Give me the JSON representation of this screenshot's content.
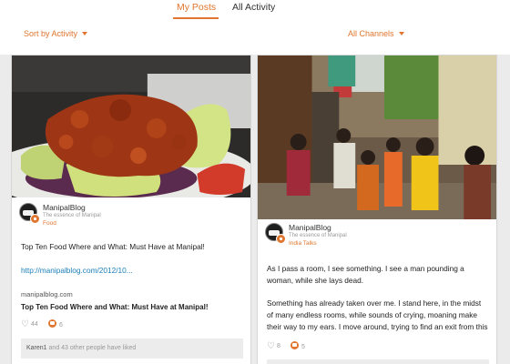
{
  "tabs": [
    {
      "label": "My Posts",
      "active": true
    },
    {
      "label": "All Activity",
      "active": false
    }
  ],
  "filters": {
    "sort_label": "Sort by Activity",
    "channels_label": "All Channels"
  },
  "posts": [
    {
      "image_alt": "fried chicken on lettuce",
      "author": "ManipalBlog",
      "author_sub": "The essence of Manipal",
      "category": "Food",
      "text": "Top Ten Food Where and What: Must Have at Manipal!",
      "link": "http://manipalblog.com/2012/10...",
      "preview_domain": "manipalblog.com",
      "preview_title": "Top Ten Food Where and What: Must Have at Manipal!",
      "likes": "44",
      "comments": "6",
      "liked_by_name": "Karen1",
      "liked_by_rest": "and 43 other people have liked"
    },
    {
      "image_alt": "crowded street",
      "author": "ManipalBlog",
      "author_sub": "The essence of Manipal",
      "category": "India Talks",
      "text_p1": "As I pass a room, I see something. I see a man pounding a woman, while she lays dead.",
      "text_p2": "Something has already taken over me. I stand here, in the midst of many endless rooms, while sounds of crying, moaning make their way to my ears. I move around, trying to find an exit from this hell",
      "likes": "8",
      "comments": "5"
    }
  ],
  "colors": {
    "accent": "#e0762f",
    "link": "#1a7fb8"
  }
}
